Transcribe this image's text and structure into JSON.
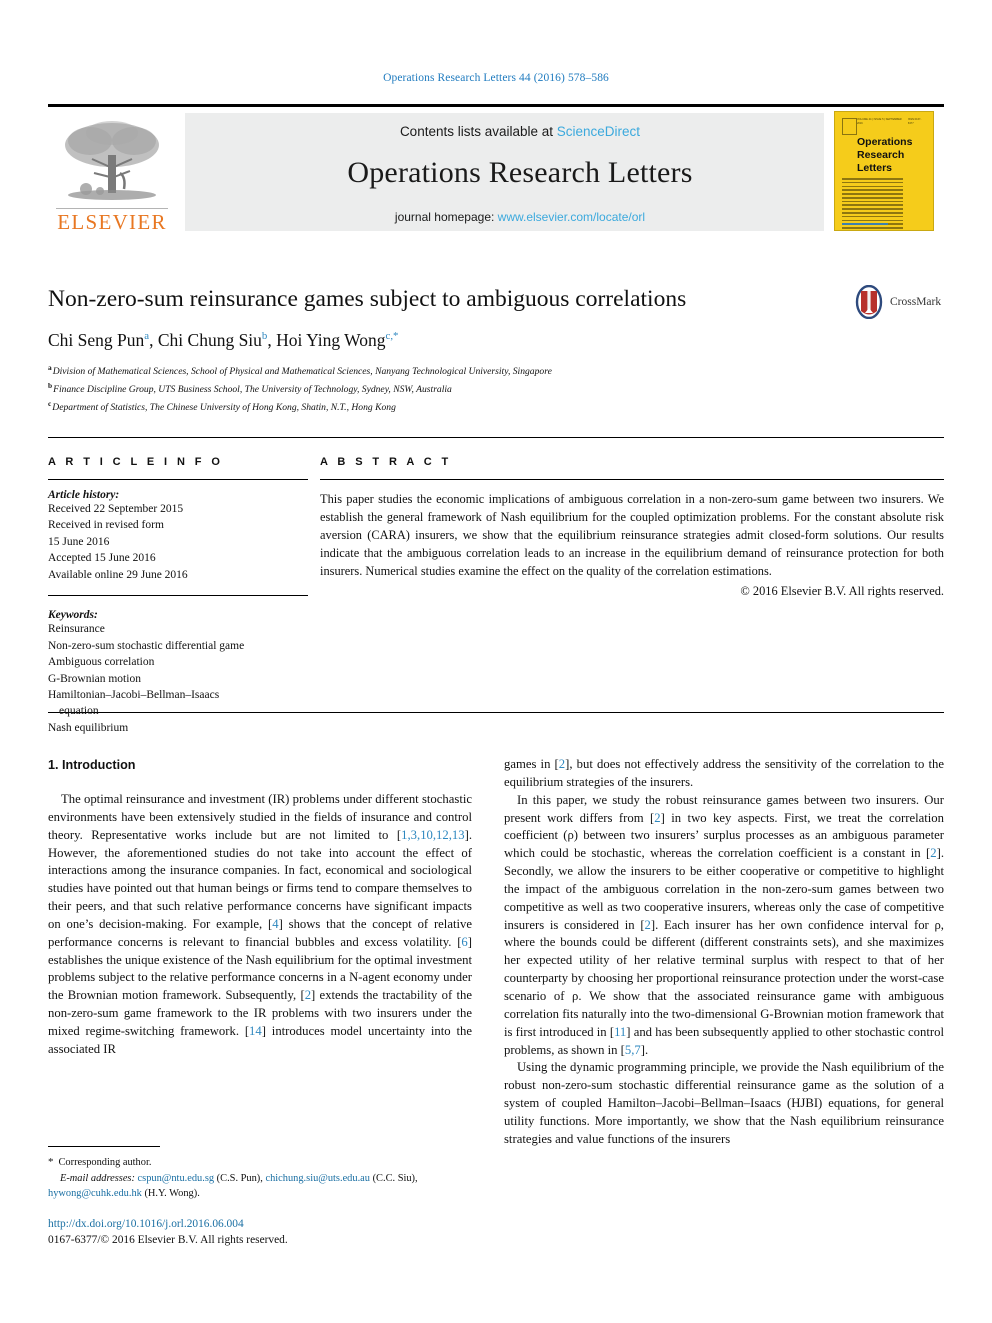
{
  "running_head": "Operations Research Letters 44 (2016) 578–586",
  "masthead": {
    "publisher_name": "ELSEVIER",
    "contents_prefix": "Contents lists available at ",
    "contents_link": "ScienceDirect",
    "journal_title": "Operations Research Letters",
    "homepage_prefix": "journal homepage: ",
    "homepage_link": "www.elsevier.com/locate/orl",
    "cover_title_line1": "Operations",
    "cover_title_line2": "Research",
    "cover_title_line3": "Letters",
    "cover_top_left": "VOLUME 44 | ISSUE 5 | SEPTEMBER 2016",
    "cover_top_right": "ISSN 0167-6377"
  },
  "article": {
    "title": "Non-zero-sum reinsurance games subject to ambiguous correlations",
    "crossmark_label": "CrossMark",
    "authors": [
      {
        "name": "Chi Seng Pun",
        "sup": "a",
        "sep": ", "
      },
      {
        "name": "Chi Chung Siu",
        "sup": "b",
        "sep": ", "
      },
      {
        "name": "Hoi Ying Wong",
        "sup": "c,*",
        "sep": ""
      }
    ],
    "affiliations": [
      {
        "mark": "a",
        "text": "Division of Mathematical Sciences, School of Physical and Mathematical Sciences, Nanyang Technological University, Singapore"
      },
      {
        "mark": "b",
        "text": "Finance Discipline Group, UTS Business School, The University of Technology, Sydney, NSW, Australia"
      },
      {
        "mark": "c",
        "text": "Department of Statistics, The Chinese University of Hong Kong, Shatin, N.T., Hong Kong"
      }
    ]
  },
  "article_info": {
    "heading": "A R T I C L E    I N F O",
    "history_label": "Article history:",
    "history": [
      "Received 22 September 2015",
      "Received in revised form",
      "15 June 2016",
      "Accepted 15 June 2016",
      "Available online 29 June 2016"
    ],
    "keywords_label": "Keywords:",
    "keywords": [
      "Reinsurance",
      "Non-zero-sum stochastic differential game",
      "Ambiguous correlation",
      "G-Brownian motion",
      "Hamiltonian–Jacobi–Bellman–Isaacs",
      "Nash equilibrium"
    ],
    "keyword_continuation": "equation"
  },
  "abstract": {
    "heading": "A B S T R A C T",
    "text": "This paper studies the economic implications of ambiguous correlation in a non-zero-sum game between two insurers. We establish the general framework of Nash equilibrium for the coupled optimization problems. For the constant absolute risk aversion (CARA) insurers, we show that the equilibrium reinsurance strategies admit closed-form solutions. Our results indicate that the ambiguous correlation leads to an increase in the equilibrium demand of reinsurance protection for both insurers. Numerical studies examine the effect on the quality of the correlation estimations.",
    "copyright": "© 2016 Elsevier B.V. All rights reserved."
  },
  "body": {
    "section_heading": "1. Introduction",
    "left_paragraphs": [
      {
        "segments": [
          {
            "t": "The optimal reinsurance and investment (IR) problems under different stochastic environments have been extensively studied in the fields of insurance and control theory. Representative works include but are not limited to [",
            "r": false
          },
          {
            "t": "1,3,10,12,13",
            "r": true
          },
          {
            "t": "]. However, the aforementioned studies do not take into account the effect of interactions among the insurance companies. In fact, economical and sociological studies have pointed out that human beings or firms tend to compare themselves to their peers, and that such relative performance concerns have significant impacts on one’s decision-making. For example, [",
            "r": false
          },
          {
            "t": "4",
            "r": true
          },
          {
            "t": "] shows that the concept of relative performance concerns is relevant to financial bubbles and excess volatility. [",
            "r": false
          },
          {
            "t": "6",
            "r": true
          },
          {
            "t": "] establishes the unique existence of the Nash equilibrium for the optimal investment problems subject to the relative performance concerns in a N-agent economy under the Brownian motion framework. Subsequently, [",
            "r": false
          },
          {
            "t": "2",
            "r": true
          },
          {
            "t": "] extends the tractability of the non-zero-sum game framework to the IR problems with two insurers under the mixed regime-switching framework. [",
            "r": false
          },
          {
            "t": "14",
            "r": true
          },
          {
            "t": "] introduces model uncertainty into the associated IR",
            "r": false
          }
        ]
      }
    ],
    "right_paragraphs": [
      {
        "indent": false,
        "segments": [
          {
            "t": "games in [",
            "r": false
          },
          {
            "t": "2",
            "r": true
          },
          {
            "t": "], but does not effectively address the sensitivity of the correlation to the equilibrium strategies of the insurers.",
            "r": false
          }
        ]
      },
      {
        "indent": true,
        "segments": [
          {
            "t": "In this paper, we study the robust reinsurance games between two insurers. Our present work differs from [",
            "r": false
          },
          {
            "t": "2",
            "r": true
          },
          {
            "t": "] in two key aspects. First, we treat the correlation coefficient (ρ) between two insurers’ surplus processes as an ambiguous parameter which could be stochastic, whereas the correlation coefficient is a constant in [",
            "r": false
          },
          {
            "t": "2",
            "r": true
          },
          {
            "t": "]. Secondly, we allow the insurers to be either cooperative or competitive to highlight the impact of the ambiguous correlation in the non-zero-sum games between two competitive as well as two cooperative insurers, whereas only the case of competitive insurers is considered in [",
            "r": false
          },
          {
            "t": "2",
            "r": true
          },
          {
            "t": "]. Each insurer has her own confidence interval for ρ, where the bounds could be different (different constraints sets), and she maximizes her expected utility of her relative terminal surplus with respect to that of her counterparty by choosing her proportional reinsurance protection under the worst-case scenario of ρ. We show that the associated reinsurance game with ambiguous correlation fits naturally into the two-dimensional G-Brownian motion framework that is first introduced in [",
            "r": false
          },
          {
            "t": "11",
            "r": true
          },
          {
            "t": "] and has been subsequently applied to other stochastic control problems, as shown in [",
            "r": false
          },
          {
            "t": "5,7",
            "r": true
          },
          {
            "t": "].",
            "r": false
          }
        ]
      },
      {
        "indent": true,
        "segments": [
          {
            "t": "Using the dynamic programming principle, we provide the Nash equilibrium of the robust non-zero-sum stochastic differential reinsurance game as the solution of a system of coupled Hamilton–Jacobi–Bellman–Isaacs (HJBI) equations, for general utility functions. More importantly, we show that the Nash equilibrium reinsurance strategies and value functions of the insurers",
            "r": false
          }
        ]
      }
    ]
  },
  "footnote": {
    "star": "*",
    "corresponding": "Corresponding author.",
    "email_label": "E-mail addresses:",
    "emails": [
      {
        "addr": "cspun@ntu.edu.sg",
        "who": " (C.S. Pun), "
      },
      {
        "addr": "chichung.siu@uts.edu.au",
        "who": " (C.C. Siu), "
      },
      {
        "addr": "hywong@cuhk.edu.hk",
        "who": " (H.Y. Wong)."
      }
    ],
    "doi": "http://dx.doi.org/10.1016/j.orl.2016.06.004",
    "issn": "0167-6377/© 2016 Elsevier B.V. All rights reserved."
  },
  "colors": {
    "link_blue": "#3ba9dd",
    "ref_blue": "#2d87bf",
    "elsevier_orange": "#e87722",
    "cover_yellow": "#f5cc1b",
    "band_gray": "#eceded"
  }
}
